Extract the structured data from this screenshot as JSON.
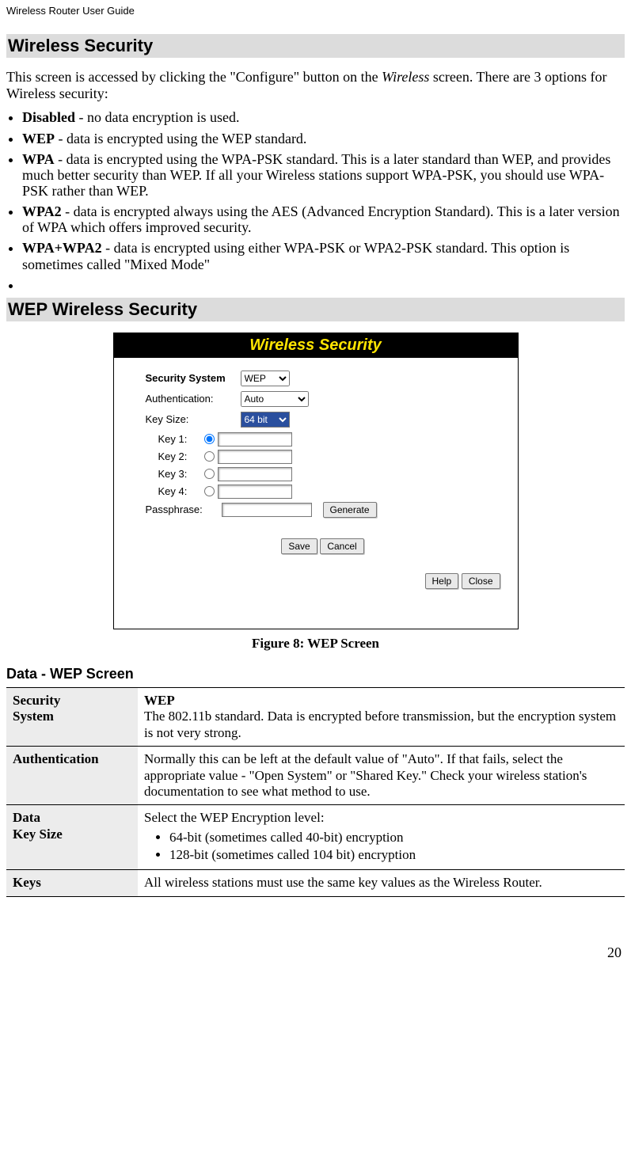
{
  "header": {
    "title": "Wireless Router User Guide"
  },
  "section1": {
    "heading": "Wireless Security",
    "intro_a": "This screen is accessed by clicking the \"Configure\" button on the ",
    "intro_italic": "Wireless",
    "intro_b": " screen. There are 3 options for Wireless security:",
    "items": [
      {
        "bold": "Disabled",
        "rest": " - no data encryption is used."
      },
      {
        "bold": "WEP",
        "rest": " - data is encrypted using the WEP standard."
      },
      {
        "bold": "WPA",
        "rest": " - data is encrypted using the WPA-PSK standard. This is a later standard than WEP, and provides much better security than WEP. If all your Wireless stations support WPA-PSK, you should use WPA-PSK rather than WEP."
      },
      {
        "bold": "WPA2",
        "rest": " - data is encrypted always using the AES (Advanced Encryption Standard). This is a later version of WPA which offers improved security."
      },
      {
        "bold": "WPA+WPA2",
        "rest": " - data is encrypted using either WPA-PSK or WPA2-PSK standard. This option is sometimes called \"Mixed Mode\""
      }
    ]
  },
  "section2": {
    "heading": "WEP Wireless Security",
    "caption": "Figure 8: WEP Screen"
  },
  "screenshot": {
    "title": "Wireless Security",
    "security_label": "Security System",
    "security_value": "WEP",
    "auth_label": "Authentication:",
    "auth_value": "Auto",
    "keysize_label": "Key Size:",
    "keysize_value": "64 bit",
    "keys": [
      "Key 1:",
      "Key 2:",
      "Key 3:",
      "Key 4:"
    ],
    "passphrase_label": "Passphrase:",
    "btn_generate": "Generate",
    "btn_save": "Save",
    "btn_cancel": "Cancel",
    "btn_help": "Help",
    "btn_close": "Close"
  },
  "section3": {
    "heading": "Data - WEP Screen",
    "rows": {
      "r1_left_a": "Security",
      "r1_left_b": "System",
      "r1_bold": "WEP",
      "r1_body": "The 802.11b standard. Data is encrypted before transmission, but the encryption system is not very strong.",
      "r2_left": "Authentication",
      "r2_body": "Normally this can be left at the default value of \"Auto\". If that fails, select the appropriate value - \"Open System\" or \"Shared Key.\" Check your wireless station's documentation to see what method to use.",
      "r3_left_a": "Data",
      "r3_left_b": "Key Size",
      "r3_body": "Select the WEP Encryption level:",
      "r3_li1": "64-bit (sometimes called 40-bit) encryption",
      "r3_li2": "128-bit (sometimes called 104 bit) encryption",
      "r4_left": "Keys",
      "r4_body": "All wireless stations must use the same key values as the Wireless Router."
    }
  },
  "page_number": "20"
}
